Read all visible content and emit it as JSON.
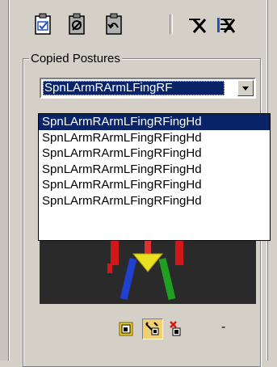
{
  "toolbar": {
    "icons": [
      "copy-posture-icon",
      "paste-posture-icon",
      "paste-opposite-posture-icon",
      "delete-posture-icon",
      "delete-all-postures-icon"
    ]
  },
  "group": {
    "label": "Copied Postures"
  },
  "combo": {
    "selected": "SpnLArmRArmLFingRF"
  },
  "dropdown": {
    "items": [
      "SpnLArmRArmLFingRFingHd",
      "SpnLArmRArmLFingRFingHd",
      "SpnLArmRArmLFingRFingHd",
      "SpnLArmRArmLFingRFingHd",
      "SpnLArmRArmLFingRFingHd",
      "SpnLArmRArmLFingRFingHd"
    ],
    "selected_index": 0
  },
  "bottom_bar": {
    "icons": [
      "capture-icon",
      "auto-capture-icon",
      "delete-capture-icon"
    ],
    "dash": "-"
  },
  "colors": {
    "highlight": "#0a246a",
    "face": "#d4d0c8",
    "viewport": "#2a2a2a"
  }
}
